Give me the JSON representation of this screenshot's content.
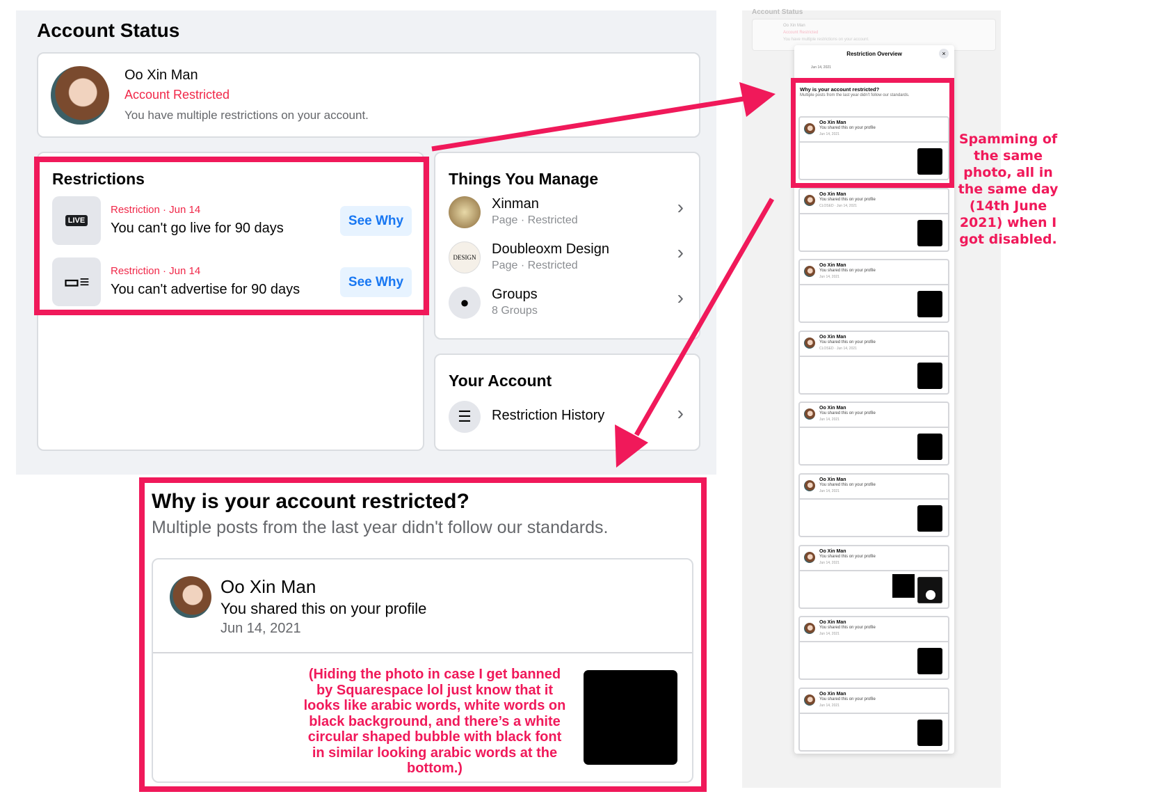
{
  "page_title": "Account Status",
  "profile": {
    "name": "Oo Xin Man",
    "status": "Account Restricted",
    "message": "You have multiple restrictions on your account."
  },
  "restrictions": {
    "title": "Restrictions",
    "items": [
      {
        "icon": "live-icon",
        "icon_text": "LIVE",
        "meta": "Restriction · Jun 14",
        "text": "You can't go live for 90 days",
        "button": "See Why"
      },
      {
        "icon": "ad-icon",
        "meta": "Restriction · Jun 14",
        "text": "You can't advertise for 90 days",
        "button": "See Why"
      }
    ]
  },
  "manage": {
    "title": "Things You Manage",
    "items": [
      {
        "name": "Xinman",
        "sub": "Page · Restricted"
      },
      {
        "name": "Doubleoxm Design",
        "sub": "Page · Restricted"
      },
      {
        "name": "Groups",
        "sub": "8 Groups"
      }
    ]
  },
  "account": {
    "title": "Your Account",
    "items": [
      {
        "name": "Restriction History"
      }
    ]
  },
  "detail": {
    "title": "Why is your account restricted?",
    "subtitle": "Multiple posts from the last year didn't follow our standards.",
    "post": {
      "name": "Oo Xin Man",
      "action": "You shared this on your profile",
      "date": "Jun 14, 2021"
    },
    "annotation": "(Hiding the photo in case I get banned by Squarespace lol just know that it looks like arabic words, white words on black background, and there’s a white circular shaped bubble with black font in similar looking arabic words at the bottom.)"
  },
  "overview": {
    "bg_title": "Account Status",
    "bg_name": "Oo Xin Man",
    "bg_status": "Account Restricted",
    "bg_message": "You have multiple restrictions on your account.",
    "modal_title": "Restriction Overview",
    "first_date": "Jun 14, 2021",
    "why_title": "Why is your account restricted?",
    "why_sub": "Multiple posts from the last year didn't follow our standards.",
    "posts": [
      {
        "name": "Oo Xin Man",
        "action": "You shared this on your profile",
        "date": "Jun 14, 2021"
      },
      {
        "name": "Oo Xin Man",
        "action": "You shared this on your profile",
        "date": "CLOSED · Jun 14, 2021"
      },
      {
        "name": "Oo Xin Man",
        "action": "You shared this on your profile",
        "date": "Jun 14, 2021"
      },
      {
        "name": "Oo Xin Man",
        "action": "You shared this on your profile",
        "date": "CLOSED · Jun 14, 2021"
      },
      {
        "name": "Oo Xin Man",
        "action": "You shared this on your profile",
        "date": "Jun 14, 2021"
      },
      {
        "name": "Oo Xin Man",
        "action": "You shared this on your profile",
        "date": "Jun 14, 2021"
      },
      {
        "name": "Oo Xin Man",
        "action": "You shared this on your profile",
        "date": "Jun 14, 2021"
      },
      {
        "name": "Oo Xin Man",
        "action": "You shared this on your profile",
        "date": "Jun 14, 2021"
      },
      {
        "name": "Oo Xin Man",
        "action": "You shared this on your profile",
        "date": "Jun 14, 2021"
      }
    ]
  },
  "side_annotation": "Spamming of the same photo, all in the same day (14th June 2021) when I got disabled.",
  "colors": {
    "highlight": "#f0195a",
    "restricted": "#f02849",
    "link": "#1877f2"
  }
}
